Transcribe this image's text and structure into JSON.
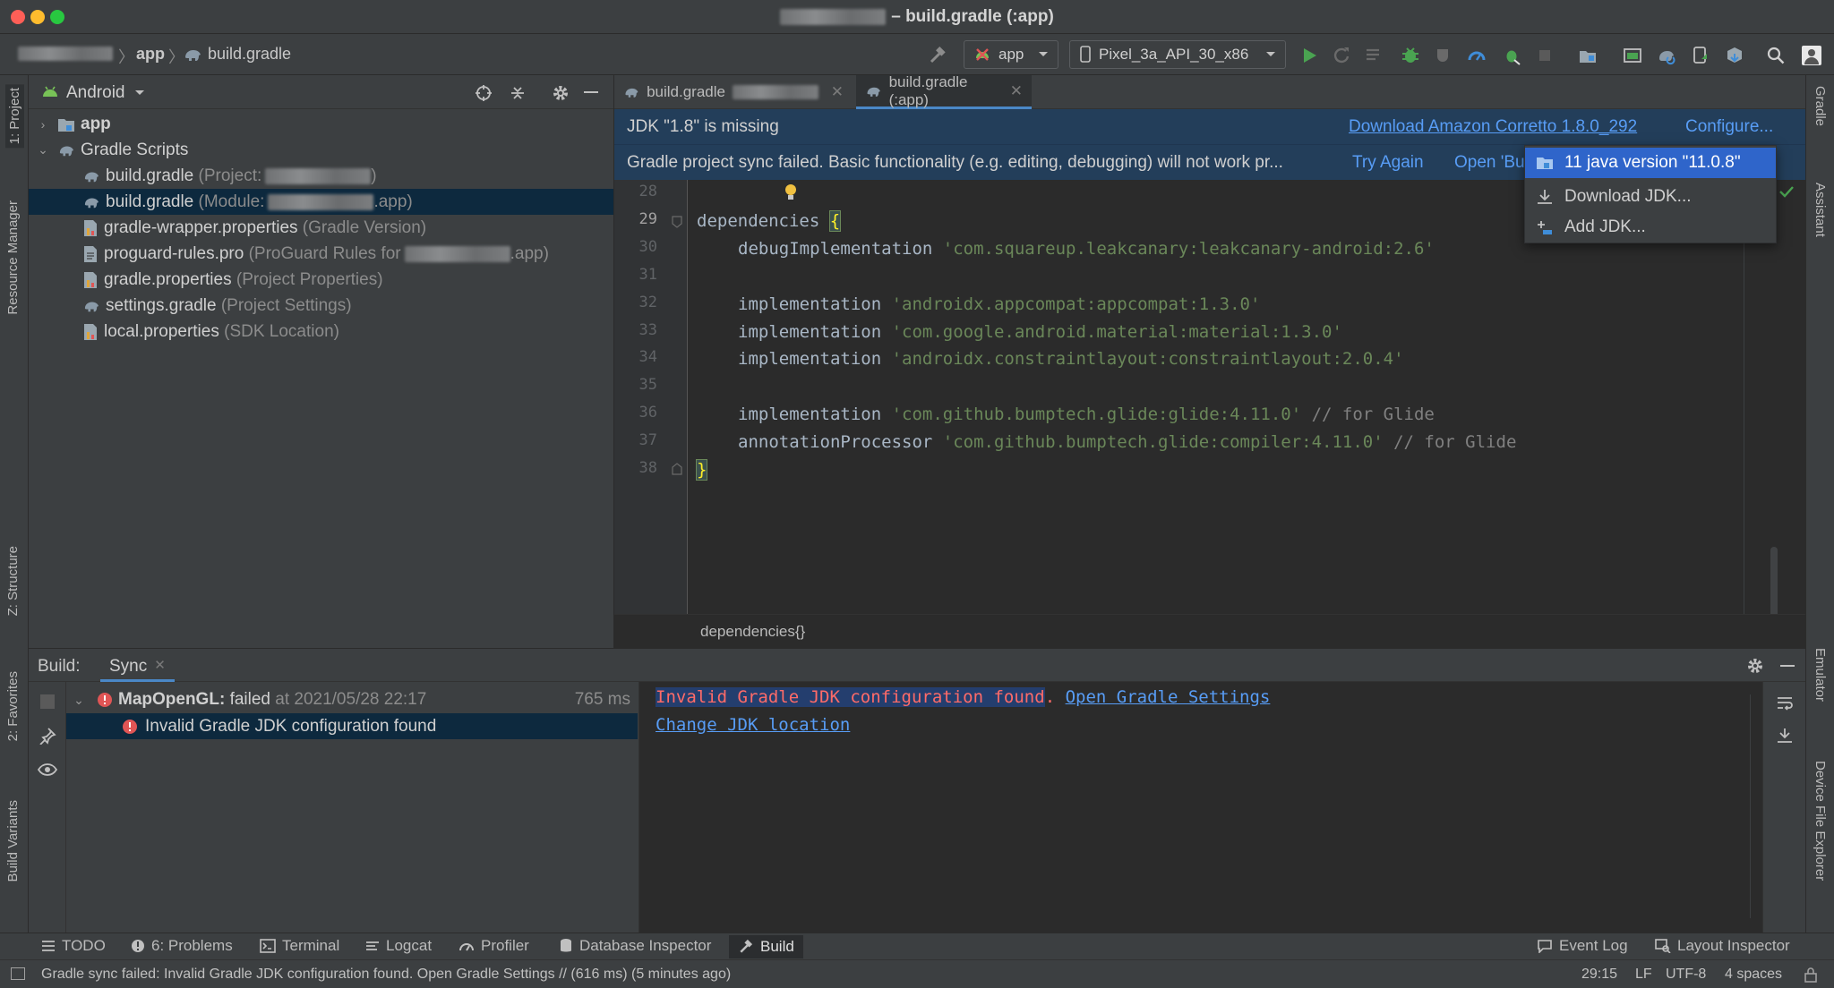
{
  "window": {
    "title": "– build.gradle (:app)"
  },
  "navbar": {
    "crumb_app": "app",
    "crumb_file": "build.gradle",
    "run_config": "app",
    "device": "Pixel_3a_API_30_x86"
  },
  "left_strip": {
    "project": "1: Project",
    "resource_manager": "Resource Manager",
    "structure": "Z: Structure",
    "favorites": "2: Favorites",
    "build_variants": "Build Variants"
  },
  "right_strip": {
    "gradle": "Gradle",
    "assistant": "Assistant",
    "emulator": "Emulator",
    "device_file_explorer": "Device File Explorer"
  },
  "project": {
    "view": "Android",
    "items": [
      {
        "label": "app",
        "hint": ""
      },
      {
        "label": "Gradle Scripts",
        "hint": ""
      },
      {
        "label": "build.gradle",
        "hint_pre": "(Project:",
        "hint_post": ")"
      },
      {
        "label": "build.gradle",
        "hint_pre": "(Module:",
        "hint_post": ".app)"
      },
      {
        "label": "gradle-wrapper.properties",
        "hint": "(Gradle Version)"
      },
      {
        "label": "proguard-rules.pro",
        "hint_pre": "(ProGuard Rules for",
        "hint_post": ".app)"
      },
      {
        "label": "gradle.properties",
        "hint": "(Project Properties)"
      },
      {
        "label": "settings.gradle",
        "hint": "(Project Settings)"
      },
      {
        "label": "local.properties",
        "hint": "(SDK Location)"
      }
    ]
  },
  "editor": {
    "tabs": [
      {
        "label": "build.gradle"
      },
      {
        "label": "build.gradle (:app)"
      }
    ],
    "banner1": {
      "text": "JDK \"1.8\" is missing",
      "download_link": "Download Amazon Corretto 1.8.0_292",
      "configure_link": "Configure..."
    },
    "banner2": {
      "text": "Gradle project sync failed. Basic functionality (e.g. editing, debugging) will not work pr...",
      "try_again": "Try Again",
      "open_partial": "Open 'Bu"
    },
    "line_numbers": [
      "28",
      "29",
      "30",
      "31",
      "32",
      "33",
      "34",
      "35",
      "36",
      "37",
      "38"
    ],
    "code": {
      "l29": "dependencies ",
      "l29_brace": "{",
      "l30_kw": "debugImplementation ",
      "l30_str": "'com.squareup.leakcanary:leakcanary-android:2.6'",
      "l32_kw": "implementation ",
      "l32_str": "'androidx.appcompat:appcompat:1.3.0'",
      "l33_kw": "implementation ",
      "l33_str": "'com.google.android.material:material:1.3.0'",
      "l34_kw": "implementation ",
      "l34_str": "'androidx.constraintlayout:constraintlayout:2.0.4'",
      "l36_kw": "implementation ",
      "l36_str": "'com.github.bumptech.glide:glide:4.11.0'",
      "l36_cmt": " // for Glide",
      "l37_kw": "annotationProcessor ",
      "l37_str": "'com.github.bumptech.glide:compiler:4.11.0'",
      "l37_cmt": " // for Glide",
      "l38": "}"
    },
    "breadcrumb": "dependencies{}"
  },
  "jdk_popup": {
    "items": [
      {
        "label": "11 java version \"11.0.8\""
      },
      {
        "label": "Download JDK..."
      },
      {
        "label": "Add JDK..."
      }
    ]
  },
  "build": {
    "label": "Build:",
    "tab": "Sync",
    "tree": {
      "project": "MapOpenGL:",
      "status": "failed",
      "when": "at 2021/05/28 22:17",
      "duration": "765 ms",
      "child": "Invalid Gradle JDK configuration found"
    },
    "output": {
      "error": "Invalid Gradle JDK configuration found",
      "dot": ".",
      "link1": "Open Gradle Settings",
      "link2": "Change JDK location"
    }
  },
  "bottom_tools": {
    "todo": "TODO",
    "problems": "6: Problems",
    "terminal": "Terminal",
    "logcat": "Logcat",
    "profiler": "Profiler",
    "database": "Database Inspector",
    "build": "Build",
    "event_log": "Event Log",
    "layout_inspector": "Layout Inspector"
  },
  "status": {
    "message": "Gradle sync failed: Invalid Gradle JDK configuration found. Open Gradle Settings // (616 ms) (5 minutes ago)",
    "position": "29:15",
    "line_sep": "LF",
    "encoding": "UTF-8",
    "indent": "4 spaces"
  },
  "colors": {
    "accent": "#4a88c7",
    "error": "#e05555",
    "link": "#589df6",
    "selection": "#2f65ca"
  }
}
